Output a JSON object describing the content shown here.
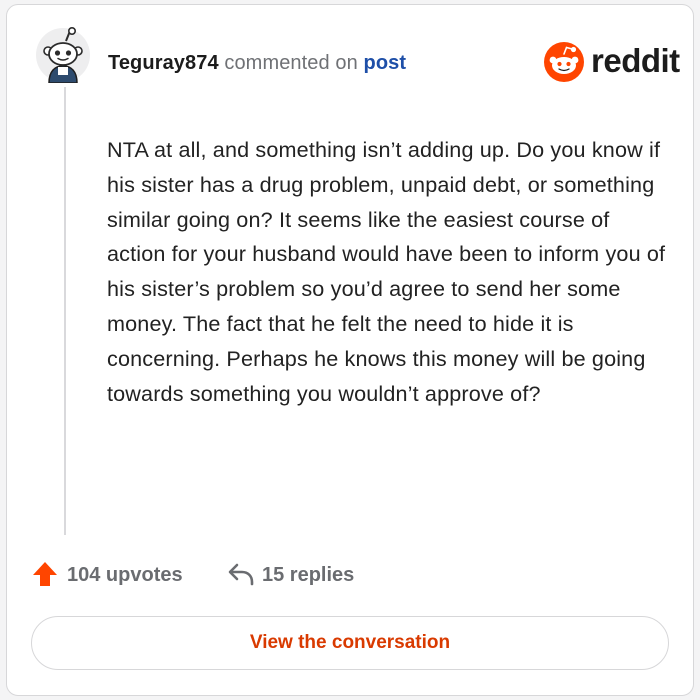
{
  "comment": {
    "username": "Teguray874",
    "action_text": "commented on",
    "post_link_label": "post",
    "body": "NTA at all, and something isn’t adding up. Do you know if his sister has a drug problem, unpaid debt, or something similar going on? It seems like the easiest course of action for your husband would have been to inform you of his sister’s problem so you’d agree to send her some money. The fact that he felt the need to hide it is concerning. Perhaps he knows this money will be going towards something you wouldn’t approve of?"
  },
  "brand": {
    "wordmark": "reddit",
    "logo_icon": "reddit-snoo-icon",
    "accent_color": "#ff4500"
  },
  "stats": {
    "upvotes_label": "104 upvotes",
    "replies_label": "15 replies",
    "upvote_icon": "upvote-arrow-icon",
    "upvote_color": "#ff4500",
    "reply_icon": "reply-arrow-icon"
  },
  "actions": {
    "view_conversation_label": "View the conversation",
    "link_color": "#d93a00"
  },
  "icons": {
    "avatar": "snoo-avatar-icon"
  }
}
